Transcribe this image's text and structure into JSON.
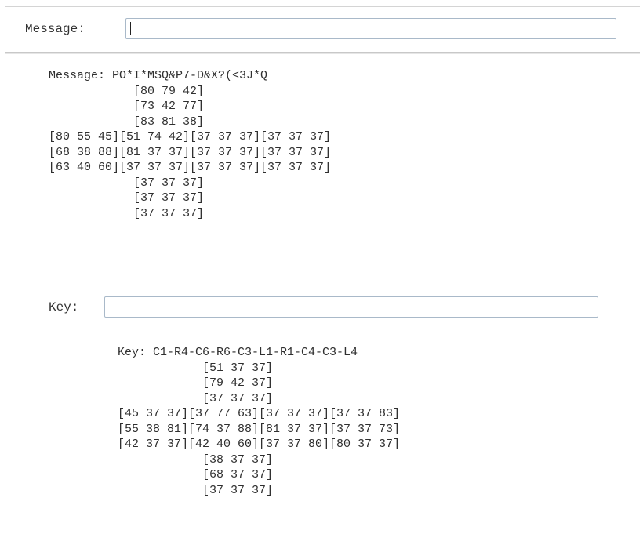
{
  "message_form": {
    "label": "Message:",
    "input_value": "",
    "input_placeholder": ""
  },
  "message_output": {
    "heading": "Message: PO*I*MSQ&P7-D&X?(<3J*Q",
    "cube_lines": [
      "            [80 79 42]",
      "            [73 42 77]",
      "            [83 81 38]",
      "[80 55 45][51 74 42][37 37 37][37 37 37]",
      "[68 38 88][81 37 37][37 37 37][37 37 37]",
      "[63 40 60][37 37 37][37 37 37][37 37 37]",
      "            [37 37 37]",
      "            [37 37 37]",
      "            [37 37 37]"
    ]
  },
  "key_form": {
    "label": "Key:",
    "input_value": "",
    "input_placeholder": ""
  },
  "key_output": {
    "heading": "Key: C1-R4-C6-R6-C3-L1-R1-C4-C3-L4",
    "cube_lines": [
      "            [51 37 37]",
      "            [79 42 37]",
      "            [37 37 37]",
      "[45 37 37][37 77 63][37 37 37][37 37 83]",
      "[55 38 81][74 37 88][81 37 37][37 37 73]",
      "[42 37 37][42 40 60][37 37 80][80 37 37]",
      "            [38 37 37]",
      "            [68 37 37]",
      "            [37 37 37]"
    ]
  }
}
